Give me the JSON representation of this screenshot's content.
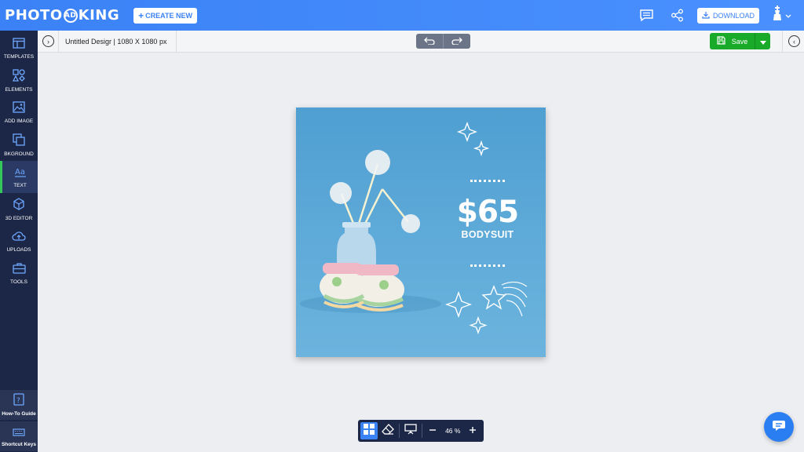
{
  "header": {
    "logo_left": "PHOTO",
    "logo_mark": "AD",
    "logo_right": "KING",
    "create_label": "CREATE NEW",
    "download_label": "DOWNLOAD"
  },
  "sidebar": {
    "items": [
      {
        "label": "TEMPLATES",
        "icon": "templates-icon"
      },
      {
        "label": "ELEMENTS",
        "icon": "elements-icon"
      },
      {
        "label": "ADD IMAGE",
        "icon": "add-image-icon"
      },
      {
        "label": "BKGROUND",
        "icon": "background-icon"
      },
      {
        "label": "TEXT",
        "icon": "text-icon"
      },
      {
        "label": "3D EDITOR",
        "icon": "cube-icon"
      },
      {
        "label": "UPLOADS",
        "icon": "upload-icon"
      },
      {
        "label": "TOOLS",
        "icon": "toolbox-icon"
      }
    ],
    "active": "TEXT",
    "bottom": [
      {
        "label": "How-To Guide",
        "icon": "help-icon"
      },
      {
        "label": "Shortcut Keys",
        "icon": "keyboard-icon"
      }
    ]
  },
  "toolbar": {
    "design_name": "Untitled Desigr",
    "design_size": "1080 X 1080 px",
    "save_label": "Save"
  },
  "canvas": {
    "price": "$65",
    "product": "BODYSUIT",
    "background_color": "#5aa9d8"
  },
  "bottombar": {
    "zoom": "46 %"
  },
  "colors": {
    "topbar": "#4a90ff",
    "sidebar": "#1c2747",
    "save": "#1aaa2a",
    "active_indicator": "#34c759"
  }
}
